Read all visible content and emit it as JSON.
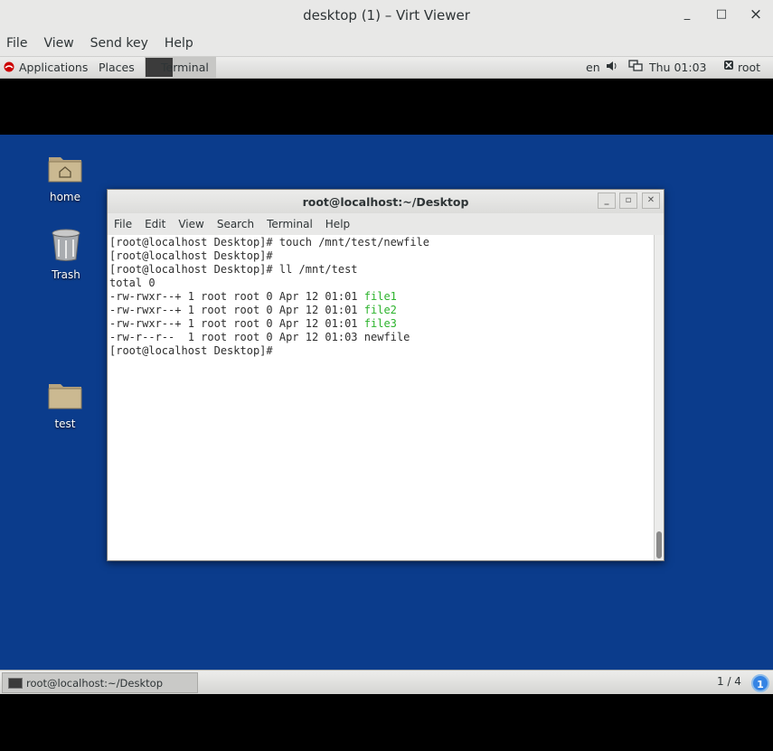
{
  "window": {
    "title": "desktop (1) – Virt Viewer",
    "minimize_glyph": "_",
    "maximize_glyph": "□",
    "close_glyph": "×"
  },
  "menubar": [
    "File",
    "View",
    "Send key",
    "Help"
  ],
  "guest": {
    "topbar": {
      "applications": "Applications",
      "places": "Places",
      "task": "Terminal",
      "lang": "en",
      "clock": "Thu 01:03",
      "user": "root"
    },
    "desktop_icons": [
      {
        "label": "home",
        "icon": "home-folder-icon"
      },
      {
        "label": "Trash",
        "icon": "trash-icon"
      },
      {
        "label": "test",
        "icon": "folder-icon"
      }
    ],
    "terminal": {
      "title": "root@localhost:~/Desktop",
      "menu": [
        "File",
        "Edit",
        "View",
        "Search",
        "Terminal",
        "Help"
      ],
      "lines": [
        {
          "text": "[root@localhost Desktop]# touch /mnt/test/newfile"
        },
        {
          "text": "[root@localhost Desktop]#"
        },
        {
          "text": "[root@localhost Desktop]# ll /mnt/test"
        },
        {
          "text": "total 0"
        },
        {
          "prefix": "-rw-rwxr--+ 1 root root 0 Apr 12 01:01 ",
          "name": "file1",
          "color": "#2cb32c"
        },
        {
          "prefix": "-rw-rwxr--+ 1 root root 0 Apr 12 01:01 ",
          "name": "file2",
          "color": "#2cb32c"
        },
        {
          "prefix": "-rw-rwxr--+ 1 root root 0 Apr 12 01:01 ",
          "name": "file3",
          "color": "#2cb32c"
        },
        {
          "prefix": "-rw-r--r--  1 root root 0 Apr 12 01:03 ",
          "name": "newfile"
        },
        {
          "text": "[root@localhost Desktop]#"
        }
      ]
    },
    "bottom": {
      "task": "root@localhost:~/Desktop",
      "workspace": "1 / 4",
      "notifications": "1"
    }
  }
}
